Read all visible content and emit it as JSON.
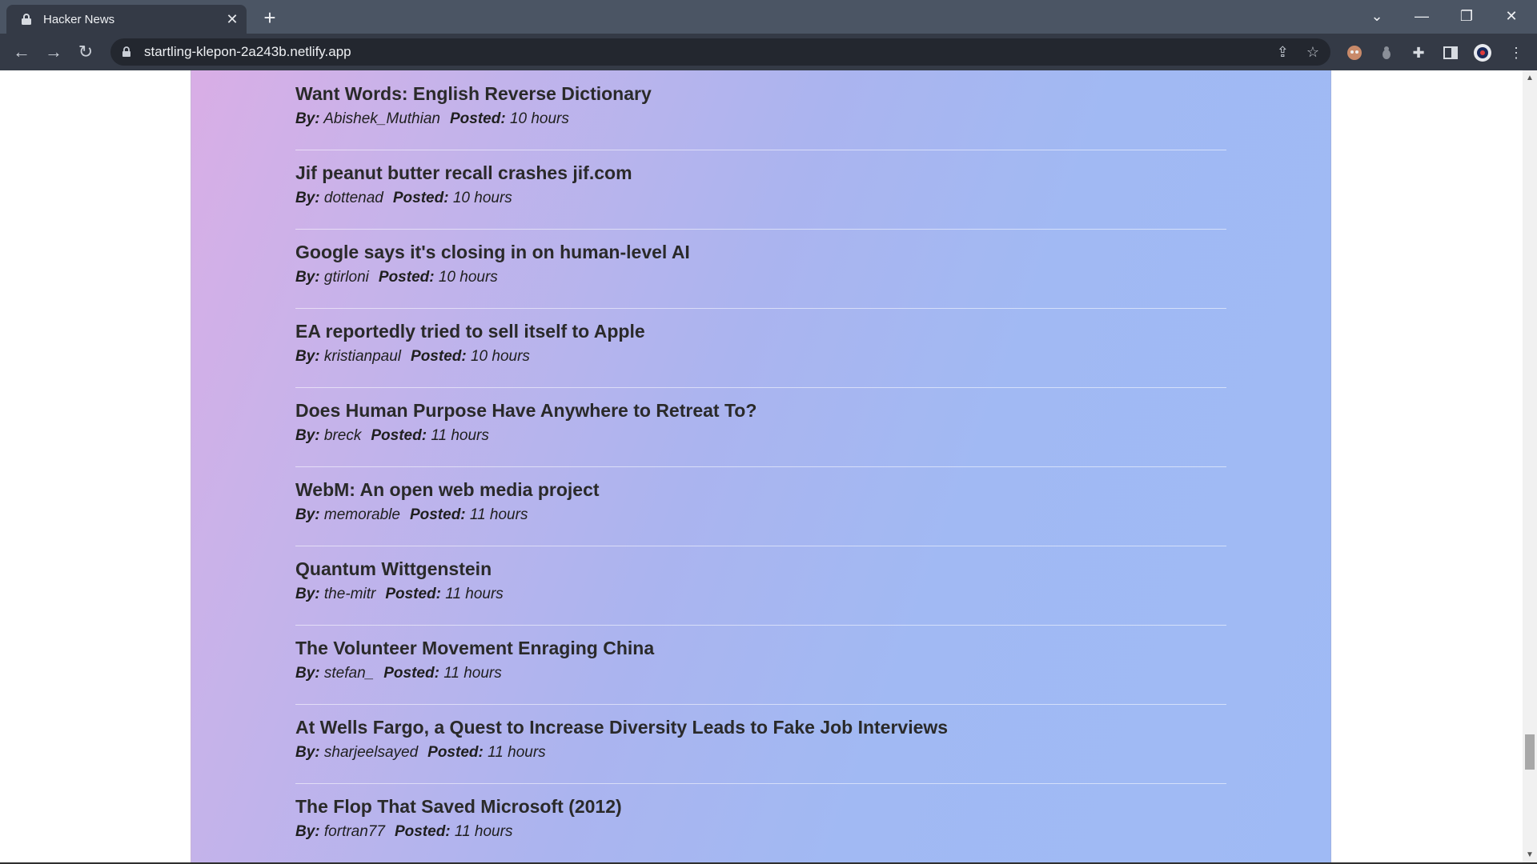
{
  "browser": {
    "tab_title": "Hacker News",
    "tab_close": "✕",
    "new_tab": "+",
    "url": "startling-klepon-2a243b.netlify.app"
  },
  "stories": [
    {
      "title": "Want Words: English Reverse Dictionary",
      "by_label": "By:",
      "author": "Abishek_Muthian",
      "posted_label": "Posted:",
      "posted": "10 hours"
    },
    {
      "title": "Jif peanut butter recall crashes jif.com",
      "by_label": "By:",
      "author": "dottenad",
      "posted_label": "Posted:",
      "posted": "10 hours"
    },
    {
      "title": "Google says it's closing in on human-level AI",
      "by_label": "By:",
      "author": "gtirloni",
      "posted_label": "Posted:",
      "posted": "10 hours"
    },
    {
      "title": "EA reportedly tried to sell itself to Apple",
      "by_label": "By:",
      "author": "kristianpaul",
      "posted_label": "Posted:",
      "posted": "10 hours"
    },
    {
      "title": "Does Human Purpose Have Anywhere to Retreat To?",
      "by_label": "By:",
      "author": "breck",
      "posted_label": "Posted:",
      "posted": "11 hours"
    },
    {
      "title": "WebM: An open web media project",
      "by_label": "By:",
      "author": "memorable",
      "posted_label": "Posted:",
      "posted": "11 hours"
    },
    {
      "title": "Quantum Wittgenstein",
      "by_label": "By:",
      "author": "the-mitr",
      "posted_label": "Posted:",
      "posted": "11 hours"
    },
    {
      "title": "The Volunteer Movement Enraging China",
      "by_label": "By:",
      "author": "stefan_",
      "posted_label": "Posted:",
      "posted": "11 hours"
    },
    {
      "title": "At Wells Fargo, a Quest to Increase Diversity Leads to Fake Job Interviews",
      "by_label": "By:",
      "author": "sharjeelsayed",
      "posted_label": "Posted:",
      "posted": "11 hours"
    },
    {
      "title": "The Flop That Saved Microsoft (2012)",
      "by_label": "By:",
      "author": "fortran77",
      "posted_label": "Posted:",
      "posted": "11 hours"
    }
  ],
  "colors": {
    "panel_gradient_start": "#d9aee6",
    "panel_gradient_end": "#9fbaf5",
    "chrome_dark": "#343a46",
    "chrome_tabbar": "#4b5564"
  }
}
